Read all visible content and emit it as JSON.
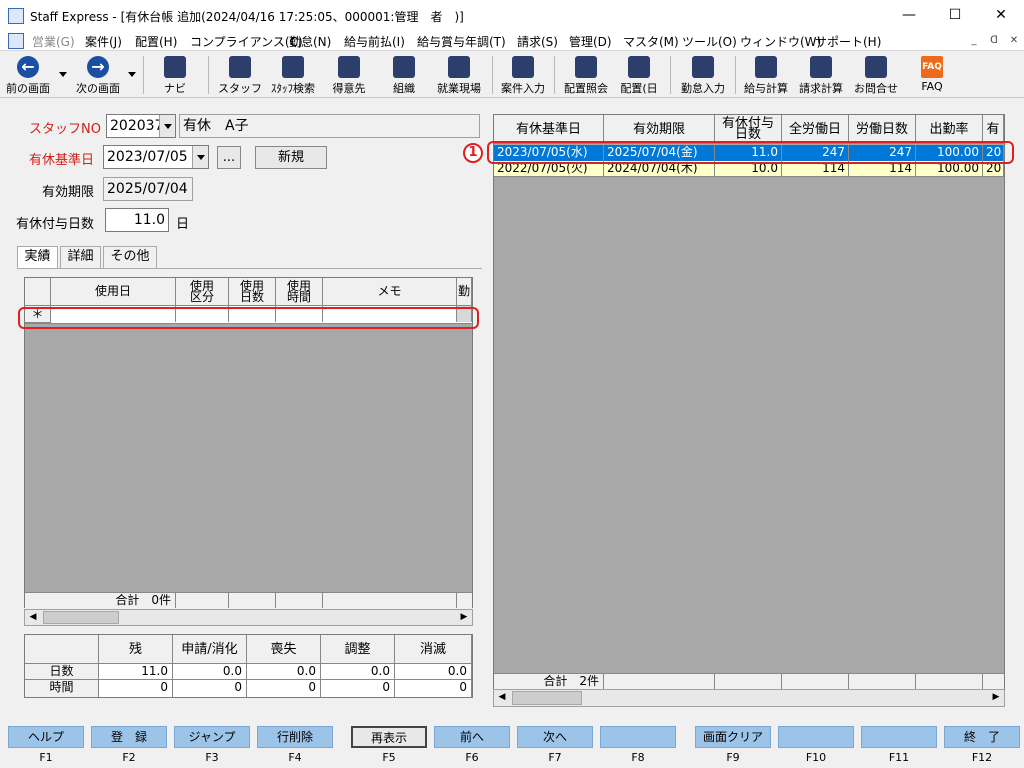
{
  "window": {
    "title": "Staff Express - [有休台帳 追加(2024/04/16 17:25:05、000001:管理　者　)]",
    "minimize": "—",
    "maximize": "☐",
    "close": "✕"
  },
  "menu": {
    "items": [
      "営業(G)",
      "案件(J)",
      "配置(H)",
      "コンプライアンス(C)",
      "勤怠(N)",
      "給与前払(I)",
      "給与賞与年調(T)",
      "請求(S)",
      "管理(D)",
      "マスタ(M)",
      "ツール(O)",
      "ウィンドウ(W)",
      "サポート(H)"
    ],
    "mdi": [
      "_",
      "ᗡ",
      "✕"
    ]
  },
  "toolbar": {
    "back": "前の画面",
    "forward": "次の画面",
    "navi": "ナビ",
    "staff": "スタッフ",
    "staff_search": "ｽﾀｯﾌ検索",
    "client": "得意先",
    "org": "組織",
    "site": "就業現場",
    "case_input": "案件入力",
    "assign_ref": "配置照会",
    "assign_day": "配置(日",
    "attendance": "勤怠入力",
    "salary_calc": "給与計算",
    "billing_calc": "請求計算",
    "inquiry": "お問合せ",
    "faq": "FAQ",
    "faq_icon_text": "FAQ"
  },
  "form": {
    "staff_no_label": "スタッフNO",
    "staff_no_value": "202037",
    "staff_name": "有休　A子",
    "base_date_label": "有休基準日",
    "base_date_value": "2023/07/05",
    "ellipsis": "...",
    "new_button": "新規",
    "expiry_label": "有効期限",
    "expiry_value": "2025/07/04",
    "grant_days_label": "有休付与日数",
    "grant_days_value": "11.0",
    "grant_days_unit": "日"
  },
  "tabs": [
    "実績",
    "詳細",
    "その他"
  ],
  "usage_grid": {
    "headers": [
      "使用日",
      "使用\n区分",
      "使用\n日数",
      "使用\n時間",
      "メモ",
      "勤"
    ],
    "new_row_marker": "＊",
    "total_label": "合計　0件"
  },
  "summary": {
    "headers": [
      "残",
      "申請/消化",
      "喪失",
      "調整",
      "消滅"
    ],
    "rows": [
      {
        "label": "日数",
        "values": [
          "11.0",
          "0.0",
          "0.0",
          "0.0",
          "0.0"
        ]
      },
      {
        "label": "時間",
        "values": [
          "0",
          "0",
          "0",
          "0",
          "0"
        ]
      }
    ]
  },
  "right_grid": {
    "headers": [
      "有休基準日",
      "有効期限",
      "有休付与\n日数",
      "全労働日",
      "労働日数",
      "出勤率",
      "有"
    ],
    "rows": [
      {
        "base": "2023/07/05(水)",
        "expiry": "2025/07/04(金)",
        "grant": "11.0",
        "all_days": "247",
        "work_days": "247",
        "rate": "100.00",
        "extra": "20",
        "selected": true
      },
      {
        "base": "2022/07/05(火)",
        "expiry": "2024/07/04(木)",
        "grant": "10.0",
        "all_days": "114",
        "work_days": "114",
        "rate": "100.00",
        "extra": "20",
        "selected": false
      }
    ],
    "total_label": "合計　2件"
  },
  "callout_badge": "1",
  "fkeys": [
    {
      "label": "ヘルプ",
      "key": "F1"
    },
    {
      "label": "登　録",
      "key": "F2"
    },
    {
      "label": "ジャンプ",
      "key": "F3"
    },
    {
      "label": "行削除",
      "key": "F4"
    },
    {
      "label": "再表示",
      "key": "F5"
    },
    {
      "label": "前へ",
      "key": "F6"
    },
    {
      "label": "次へ",
      "key": "F7"
    },
    {
      "label": "",
      "key": "F8"
    },
    {
      "label": "画面クリア",
      "key": "F9"
    },
    {
      "label": "",
      "key": "F10"
    },
    {
      "label": "",
      "key": "F11"
    },
    {
      "label": "終　了",
      "key": "F12"
    }
  ],
  "colors": {
    "accent_red": "#e02020",
    "selected_row": "#0078d7",
    "alt_row": "#ffffc8",
    "fkey": "#9cc3e8"
  }
}
